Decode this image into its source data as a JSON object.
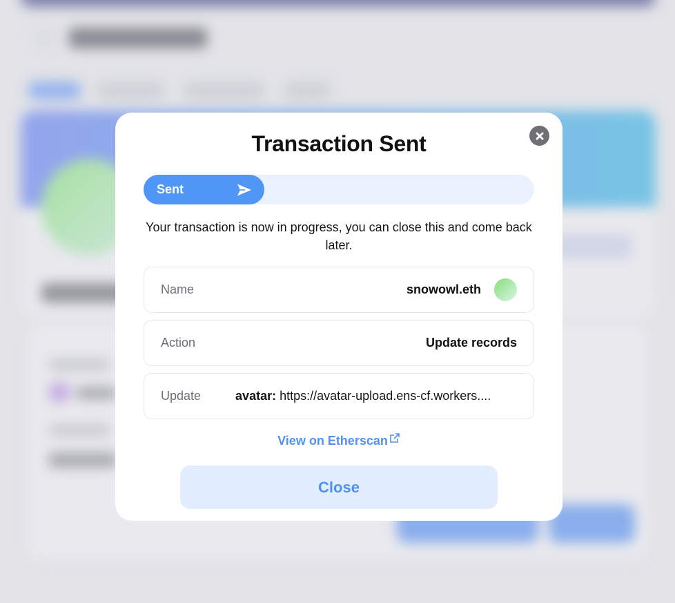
{
  "modal": {
    "title": "Transaction Sent",
    "progress": {
      "label": "Sent",
      "fraction": 0.31
    },
    "message": "Your transaction is now in progress, you can close this and come back later.",
    "rows": {
      "name": {
        "label": "Name",
        "value": "snowowl.eth"
      },
      "action": {
        "label": "Action",
        "value": "Update records"
      },
      "update": {
        "label": "Update",
        "key": "avatar:",
        "value": "https://avatar-upload.ens-cf.workers...."
      }
    },
    "etherscan_link": "View on Etherscan",
    "close_button": "Close"
  },
  "icons": {
    "dismiss": "close-icon",
    "progress": "send-arrow-icon",
    "link": "external-link-icon"
  },
  "colors": {
    "accent": "#5096f7",
    "accent_light": "#eaf2fe",
    "button_bg": "#e2eefd",
    "link": "#4f92ef",
    "close_icon_bg": "#6f6f74"
  }
}
